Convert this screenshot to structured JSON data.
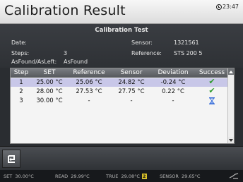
{
  "header": {
    "title": "Calibration Result",
    "clock": "23:47"
  },
  "info": {
    "section_title": "Calibration Test",
    "date_label": "Date:",
    "date_value": "",
    "steps_label": "Steps:",
    "steps_value": "3",
    "asfound_label": "AsFound/AsLeft:",
    "asfound_value": "AsFound",
    "sensor_label": "Sensor:",
    "sensor_value": "1321561",
    "reference_label": "Reference:",
    "reference_value": "STS 200 5"
  },
  "table": {
    "headers": [
      "Step",
      "SET",
      "Reference",
      "Sensor",
      "Deviation",
      "Success"
    ],
    "rows": [
      {
        "step": "1",
        "set": "25.00 °C",
        "reference": "25.06 °C",
        "sensor": "24.82 °C",
        "deviation": "-0.24 °C",
        "success": "check-icon"
      },
      {
        "step": "2",
        "set": "28.00 °C",
        "reference": "27.53 °C",
        "sensor": "27.75 °C",
        "deviation": "0.22 °C",
        "success": "check-icon"
      },
      {
        "step": "3",
        "set": "30.00 °C",
        "reference": "-",
        "sensor": "-",
        "deviation": "-",
        "success": "hourglass-icon"
      }
    ],
    "selected_row": 0
  },
  "statusbar": {
    "set_label": "SET",
    "set_value": "30.00°C",
    "read_label": "READ",
    "read_value": "29.99°C",
    "true_label": "TRUE",
    "true_value": "29.08°C",
    "true_badge": "2",
    "sensor_label": "SENSOR",
    "sensor_value": "29.65°C"
  },
  "colors": {
    "selected_row": "#c8c7e8",
    "success": "#2f9a2f",
    "hourglass": "#3a6fd8",
    "badge": "#d9c12a"
  }
}
